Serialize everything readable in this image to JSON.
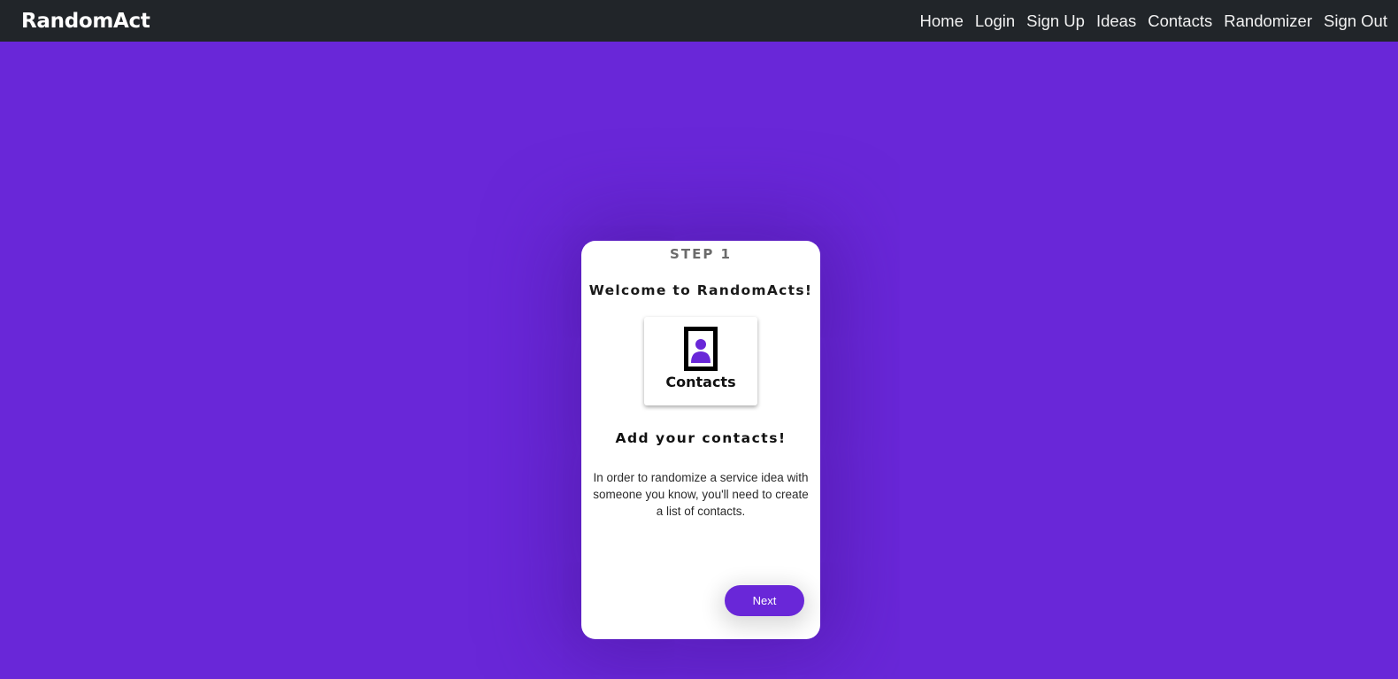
{
  "navbar": {
    "brand": "RandomAct",
    "links": [
      "Home",
      "Login",
      "Sign Up",
      "Ideas",
      "Contacts",
      "Randomizer",
      "Sign Out"
    ]
  },
  "card": {
    "step_label": "STEP 1",
    "welcome": "Welcome to RandomActs!",
    "tile": {
      "icon": "contact-portrait-icon",
      "label": "Contacts"
    },
    "heading": "Add your contacts!",
    "text": "In order to randomize a service idea with someone you know, you'll need to create a list of contacts.",
    "next_label": "Next"
  },
  "colors": {
    "background": "#6927d8",
    "navbar": "#212529",
    "accent": "#6927d8",
    "card": "#ffffff"
  }
}
